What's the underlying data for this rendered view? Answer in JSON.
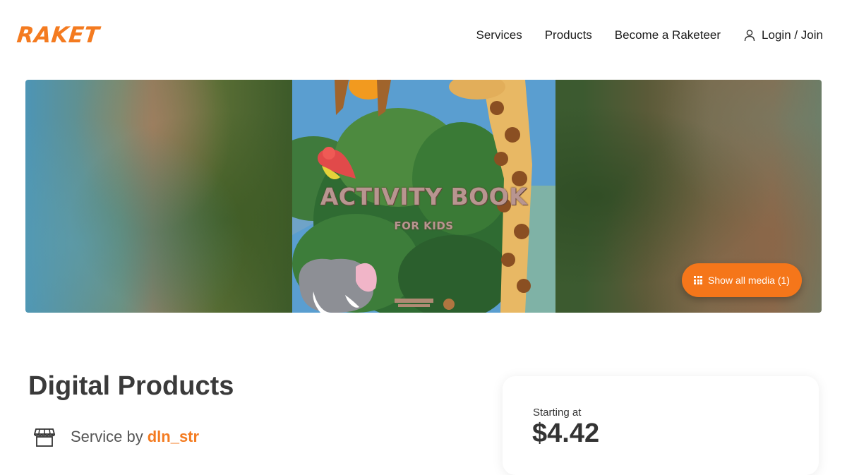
{
  "brand": {
    "logo_text": "RAKET",
    "accent": "#f47b20"
  },
  "nav": {
    "items": [
      "Services",
      "Products",
      "Become a Raketeer"
    ],
    "login_label": "Login / Join",
    "login_icon": "user-icon"
  },
  "hero": {
    "cover_title": "ACTIVITY BOOK",
    "cover_subtitle": "FOR KIDS",
    "show_media_label": "Show all media (1)",
    "show_media_icon": "grid-icon",
    "button_color": "#f5761a"
  },
  "listing": {
    "title": "Digital Products",
    "service_by_label": "Service by",
    "seller": "dln_str",
    "store_icon": "store-icon"
  },
  "pricing": {
    "starting_label": "Starting at",
    "price": "$4.42"
  }
}
